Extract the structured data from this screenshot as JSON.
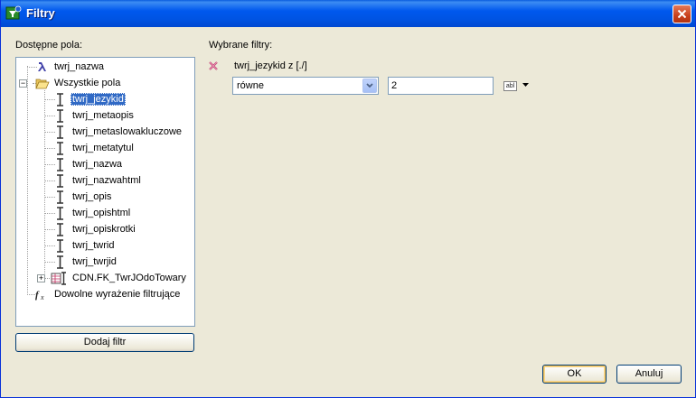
{
  "window": {
    "title": "Filtry"
  },
  "left": {
    "label": "Dostępne pola:",
    "tree": {
      "root_nazwa": "twrj_nazwa",
      "group": "Wszystkie pola",
      "fields": [
        "twrj_jezykid",
        "twrj_metaopis",
        "twrj_metaslowakluczowe",
        "twrj_metatytul",
        "twrj_nazwa",
        "twrj_nazwahtml",
        "twrj_opis",
        "twrj_opishtml",
        "twrj_opiskrotki",
        "twrj_twrid",
        "twrj_twrjid"
      ],
      "relation": "CDN.FK_TwrJOdoTowary",
      "expression": "Dowolne wyrażenie filtrujące",
      "selected": "twrj_jezykid"
    },
    "add_button": "Dodaj filtr"
  },
  "right": {
    "label": "Wybrane filtry:",
    "filter": {
      "title": "twrj_jezykid z [./]",
      "operator": "równe",
      "value": "2",
      "type_icon": "abl"
    }
  },
  "footer": {
    "ok": "OK",
    "cancel": "Anuluj"
  },
  "colors": {
    "titlebar": "#0054e3",
    "selection": "#316ac5",
    "dialog_bg": "#ece9d8"
  },
  "icons": {
    "title": "filter-app-icon",
    "close": "close-icon",
    "lambda": "lambda-icon",
    "folder": "open-folder-icon",
    "field": "field-ibeam-icon",
    "relation": "relation-table-icon",
    "fx": "function-icon",
    "remove": "remove-filter-icon"
  }
}
